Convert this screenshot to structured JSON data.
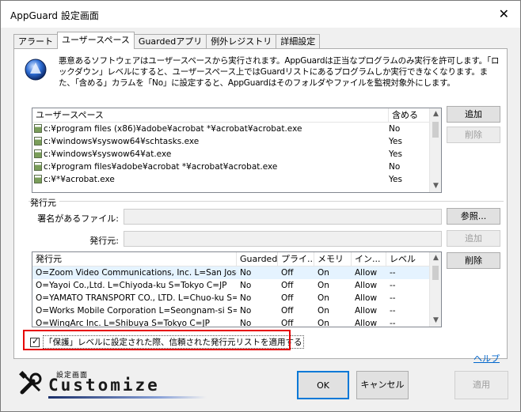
{
  "window": {
    "title": "AppGuard 設定画面",
    "close_glyph": "✕"
  },
  "tabs": [
    {
      "label": "アラート",
      "active": false
    },
    {
      "label": "ユーザースペース",
      "active": true
    },
    {
      "label": "Guardedアプリ",
      "active": false
    },
    {
      "label": "例外レジストリ",
      "active": false
    },
    {
      "label": "詳細設定",
      "active": false
    }
  ],
  "description": "悪意あるソフトウェアはユーザースペースから実行されます。AppGuardは正当なプログラムのみ実行を許可します。「ロックダウン」レベルにすると、ユーザースペース上ではGuardリストにあるプログラムしか実行できなくなります。また、「含める」カラムを「No」に設定すると、AppGuardはそのフォルダやファイルを監視対象外にします。",
  "userspace": {
    "headers": [
      "ユーザースペース",
      "含める"
    ],
    "rows": [
      {
        "path": "c:¥program files (x86)¥adobe¥acrobat *¥acrobat¥acrobat.exe",
        "include": "No"
      },
      {
        "path": "c:¥windows¥syswow64¥schtasks.exe",
        "include": "Yes"
      },
      {
        "path": "c:¥windows¥syswow64¥at.exe",
        "include": "Yes"
      },
      {
        "path": "c:¥program files¥adobe¥acrobat *¥acrobat¥acrobat.exe",
        "include": "No"
      },
      {
        "path": "c:¥*¥acrobat.exe",
        "include": "Yes"
      }
    ],
    "add_label": "追加",
    "delete_label": "削除"
  },
  "publisher_group": {
    "label": "発行元",
    "signed_file_label": "署名があるファイル:",
    "publisher_label": "発行元:",
    "browse_label": "参照...",
    "add_label": "追加",
    "delete_label": "削除",
    "headers": [
      "発行元",
      "Guarded",
      "プライ...",
      "メモリ",
      "イン...",
      "レベル"
    ],
    "rows": [
      [
        "O=Zoom Video Communications, Inc. L=San Jose S=...",
        "No",
        "Off",
        "On",
        "Allow",
        "--"
      ],
      [
        "O=Yayoi Co.,Ltd. L=Chiyoda-ku S=Tokyo C=JP",
        "No",
        "Off",
        "On",
        "Allow",
        "--"
      ],
      [
        "O=YAMATO TRANSPORT CO., LTD. L=Chuo-ku S=Tokyo ...",
        "No",
        "Off",
        "On",
        "Allow",
        "--"
      ],
      [
        "O=Works Mobile Corporation L=Seongnam-si S=Gye...",
        "No",
        "Off",
        "On",
        "Allow",
        "--"
      ],
      [
        "O=WingArc Inc. L=Shibuya S=Tokyo C=JP",
        "No",
        "Off",
        "On",
        "Allow",
        "--"
      ]
    ]
  },
  "checkbox": {
    "label": "「保護」レベルに設定された際、信頼された発行元リストを適用する",
    "checked": true
  },
  "help_label": "ヘルプ",
  "logo": {
    "sub": "設定画面",
    "main": "Customize"
  },
  "buttons": {
    "ok": "OK",
    "cancel": "キャンセル",
    "apply": "適用"
  },
  "colors": {
    "highlight": "#e60000",
    "selected_row": "#e5f3ff",
    "link": "#0066cc"
  }
}
